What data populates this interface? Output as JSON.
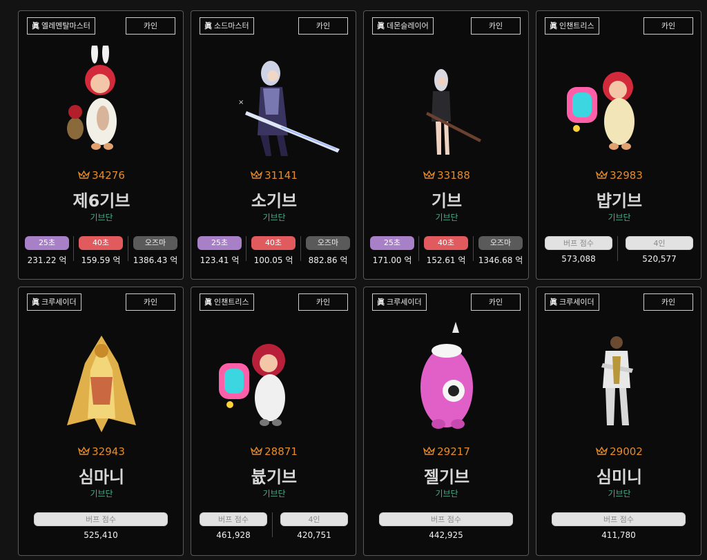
{
  "cards": [
    {
      "job": "엘레멘탈마스터",
      "server": "카인",
      "score": "34276",
      "name": "제6기브",
      "guild": "기브단",
      "sprite": "bunny-mage-sprite",
      "stats": [
        {
          "label": "25초",
          "value": "231.22 억",
          "color": "purple"
        },
        {
          "label": "40초",
          "value": "159.59 억",
          "color": "red"
        },
        {
          "label": "오즈마",
          "value": "1386.43 억",
          "color": "gray"
        }
      ]
    },
    {
      "job": "소드마스터",
      "server": "카인",
      "score": "31141",
      "name": "소기브",
      "guild": "기브단",
      "sprite": "swordmaster-sprite",
      "stats": [
        {
          "label": "25초",
          "value": "123.41 억",
          "color": "purple"
        },
        {
          "label": "40초",
          "value": "100.05 억",
          "color": "red"
        },
        {
          "label": "오즈마",
          "value": "882.86 억",
          "color": "gray"
        }
      ]
    },
    {
      "job": "데몬슬레이어",
      "server": "카인",
      "score": "33188",
      "name": "기브",
      "guild": "기브단",
      "sprite": "demon-slayer-sprite",
      "stats": [
        {
          "label": "25초",
          "value": "171.00 억",
          "color": "purple"
        },
        {
          "label": "40초",
          "value": "152.61 억",
          "color": "red"
        },
        {
          "label": "오즈마",
          "value": "1346.68 억",
          "color": "gray"
        }
      ]
    },
    {
      "job": "인챈트리스",
      "server": "카인",
      "score": "32983",
      "name": "뱝기브",
      "guild": "기브단",
      "sprite": "enchantress-sprite",
      "stats": [
        {
          "label": "버프 점수",
          "value": "573,088",
          "color": "light"
        },
        {
          "label": "4인",
          "value": "520,577",
          "color": "light"
        }
      ]
    },
    {
      "job": "크루세이더",
      "server": "카인",
      "score": "32943",
      "name": "심마니",
      "guild": "기브단",
      "sprite": "golden-crusader-sprite",
      "stats": [
        {
          "label": "버프 점수",
          "value": "525,410",
          "color": "light"
        }
      ]
    },
    {
      "job": "인챈트리스",
      "server": "카인",
      "score": "28871",
      "name": "븂기브",
      "guild": "기브단",
      "sprite": "enchantress-sprite",
      "stats": [
        {
          "label": "버프 점수",
          "value": "461,928",
          "color": "light"
        },
        {
          "label": "4인",
          "value": "420,751",
          "color": "light"
        }
      ]
    },
    {
      "job": "크루세이더",
      "server": "카인",
      "score": "29217",
      "name": "젤기브",
      "guild": "기브단",
      "sprite": "pink-mascot-sprite",
      "stats": [
        {
          "label": "버프 점수",
          "value": "442,925",
          "color": "light"
        }
      ]
    },
    {
      "job": "크루세이더",
      "server": "카인",
      "score": "29002",
      "name": "심미니",
      "guild": "기브단",
      "sprite": "white-crusader-sprite",
      "stats": [
        {
          "label": "버프 점수",
          "value": "411,780",
          "color": "light"
        }
      ]
    }
  ],
  "job_badge_prefix": "眞",
  "colors": {
    "background": "#131313",
    "card": "#0b0b0b",
    "score": "#e58b2b",
    "guild": "#4cab8a",
    "purple": "#a880c8",
    "red": "#e05a5e",
    "gray": "#5a5a5a",
    "light": "#e2e2e2"
  }
}
